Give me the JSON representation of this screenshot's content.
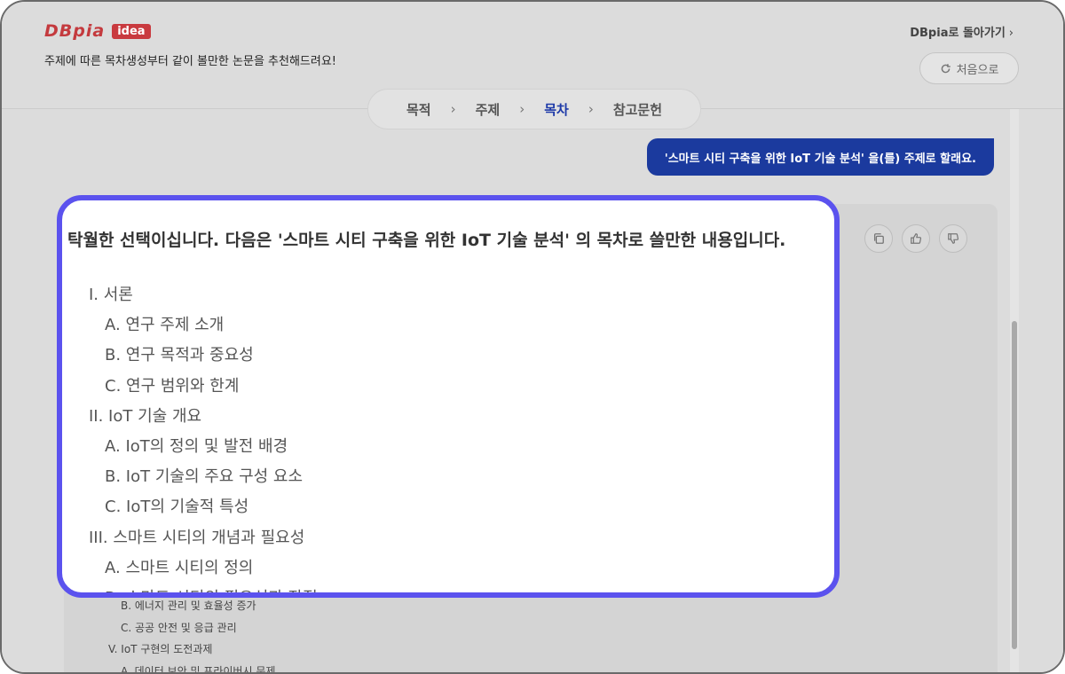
{
  "header": {
    "logo_text": "DBpia",
    "logo_badge": "idea",
    "tagline": "주제에 따른 목차생성부터 같이 볼만한 논문을 추천해드려요!",
    "back_link": "DBpia로 돌아가기",
    "restart_label": "처음으로"
  },
  "steps": [
    {
      "label": "목적",
      "active": false
    },
    {
      "label": "주제",
      "active": false
    },
    {
      "label": "목차",
      "active": true
    },
    {
      "label": "참고문헌",
      "active": false
    }
  ],
  "user_message": "'스마트 시티 구축을 위한 IoT 기술 분석' 을(를) 주제로 할래요.",
  "answer": {
    "title": "탁월한 선택이십니다. 다음은 '스마트 시티 구축을 위한 IoT 기술 분석' 의 목차로 쓸만한 내용입니다.",
    "toc": [
      "I. 서론",
      "A. 연구 주제 소개",
      "B. 연구 목적과 중요성",
      "C. 연구 범위와 한계",
      "II. IoT 기술 개요",
      "A. IoT의 정의 및 발전 배경",
      "B. IoT 기술의 주요 구성 요소",
      "C. IoT의 기술적 특성",
      "III. 스마트 시티의 개념과 필요성",
      "A. 스마트 시티의 정의",
      "B. 스마트 시티의 필요성과 장점"
    ],
    "background_items": [
      "B. 에너지 관리 및 효율성 증가",
      "C. 공공 안전 및 응급 관리",
      "V. IoT 구현의 도전과제",
      "A. 데이터 보안 및 프라이버시 문제"
    ]
  },
  "icons": {
    "copy": "copy-icon",
    "like": "thumbs-up-icon",
    "dislike": "thumbs-down-icon",
    "refresh": "refresh-icon"
  },
  "colors": {
    "accent": "#1b3a9e",
    "overlay_border": "#5b52ee",
    "brand": "#c43a3e"
  }
}
